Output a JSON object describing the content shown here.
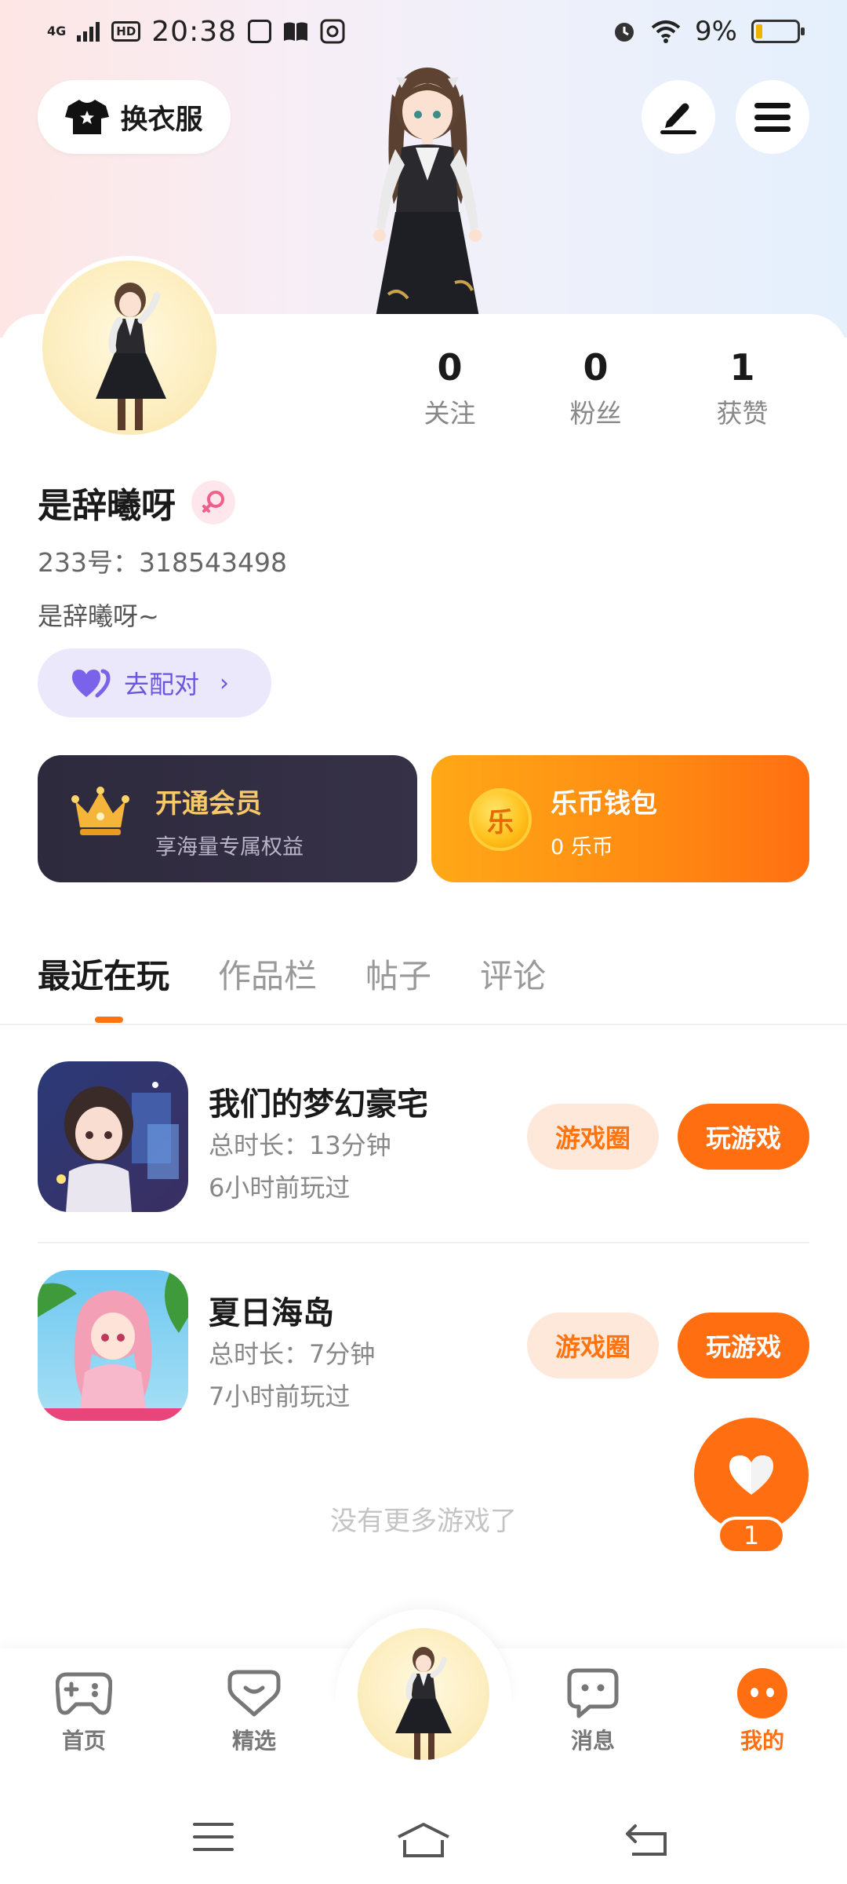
{
  "status_bar": {
    "network": "4G",
    "hd": "HD",
    "time": "20:38",
    "battery": "9%"
  },
  "header": {
    "dress_button_label": "换衣服"
  },
  "profile": {
    "stats": [
      {
        "value": "0",
        "label": "关注"
      },
      {
        "value": "0",
        "label": "粉丝"
      },
      {
        "value": "1",
        "label": "获赞"
      }
    ],
    "name": "是辞曦呀",
    "id_line": "233号：318543498",
    "bio": "是辞曦呀~",
    "match_label": "去配对"
  },
  "cards": {
    "vip": {
      "title": "开通会员",
      "subtitle": "享海量专属权益"
    },
    "wallet": {
      "icon_text": "乐",
      "title": "乐币钱包",
      "subtitle": "0  乐币"
    }
  },
  "tabs": [
    {
      "label": "最近在玩",
      "active": true
    },
    {
      "label": "作品栏",
      "active": false
    },
    {
      "label": "帖子",
      "active": false
    },
    {
      "label": "评论",
      "active": false
    }
  ],
  "games": [
    {
      "title": "我们的梦幻豪宅",
      "duration": "总时长：13分钟",
      "last_played": "6小时前玩过",
      "circle_label": "游戏圈",
      "play_label": "玩游戏"
    },
    {
      "title": "夏日海岛",
      "duration": "总时长：7分钟",
      "last_played": "7小时前玩过",
      "circle_label": "游戏圈",
      "play_label": "玩游戏"
    }
  ],
  "no_more_text": "没有更多游戏了",
  "like": {
    "count": "1"
  },
  "bottom_nav": [
    {
      "label": "首页",
      "icon": "gamepad-icon"
    },
    {
      "label": "精选",
      "icon": "heart-badge-icon"
    },
    {
      "label": "消息",
      "icon": "chat-bubble-icon"
    },
    {
      "label": "我的",
      "icon": "profile-face-icon",
      "active": true
    }
  ],
  "colors": {
    "accent": "#ff6f12",
    "match": "#6b55e0",
    "vip_gold": "#f7c86a"
  }
}
